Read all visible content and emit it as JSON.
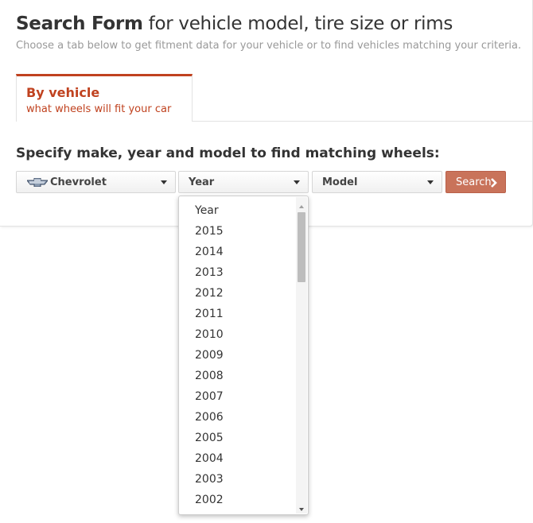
{
  "header": {
    "title_strong": "Search Form",
    "title_rest": " for vehicle model, tire size or rims",
    "subtitle": "Choose a tab below to get fitment data for your vehicle or to find vehicles matching your criteria."
  },
  "tabs": [
    {
      "title": "By vehicle",
      "subtitle": "what wheels will fit your car"
    }
  ],
  "form": {
    "heading": "Specify make, year and model to find matching wheels:",
    "make": {
      "value": "Chevrolet",
      "icon": "chevrolet-bowtie-icon"
    },
    "year": {
      "value": "Year"
    },
    "model": {
      "value": "Model"
    },
    "search_label": "Search"
  },
  "year_dropdown": {
    "options": [
      "Year",
      "2015",
      "2014",
      "2013",
      "2012",
      "2011",
      "2010",
      "2009",
      "2008",
      "2007",
      "2006",
      "2005",
      "2004",
      "2003",
      "2002"
    ]
  },
  "colors": {
    "accent": "#c0421f",
    "search_button": "#c9735a"
  }
}
